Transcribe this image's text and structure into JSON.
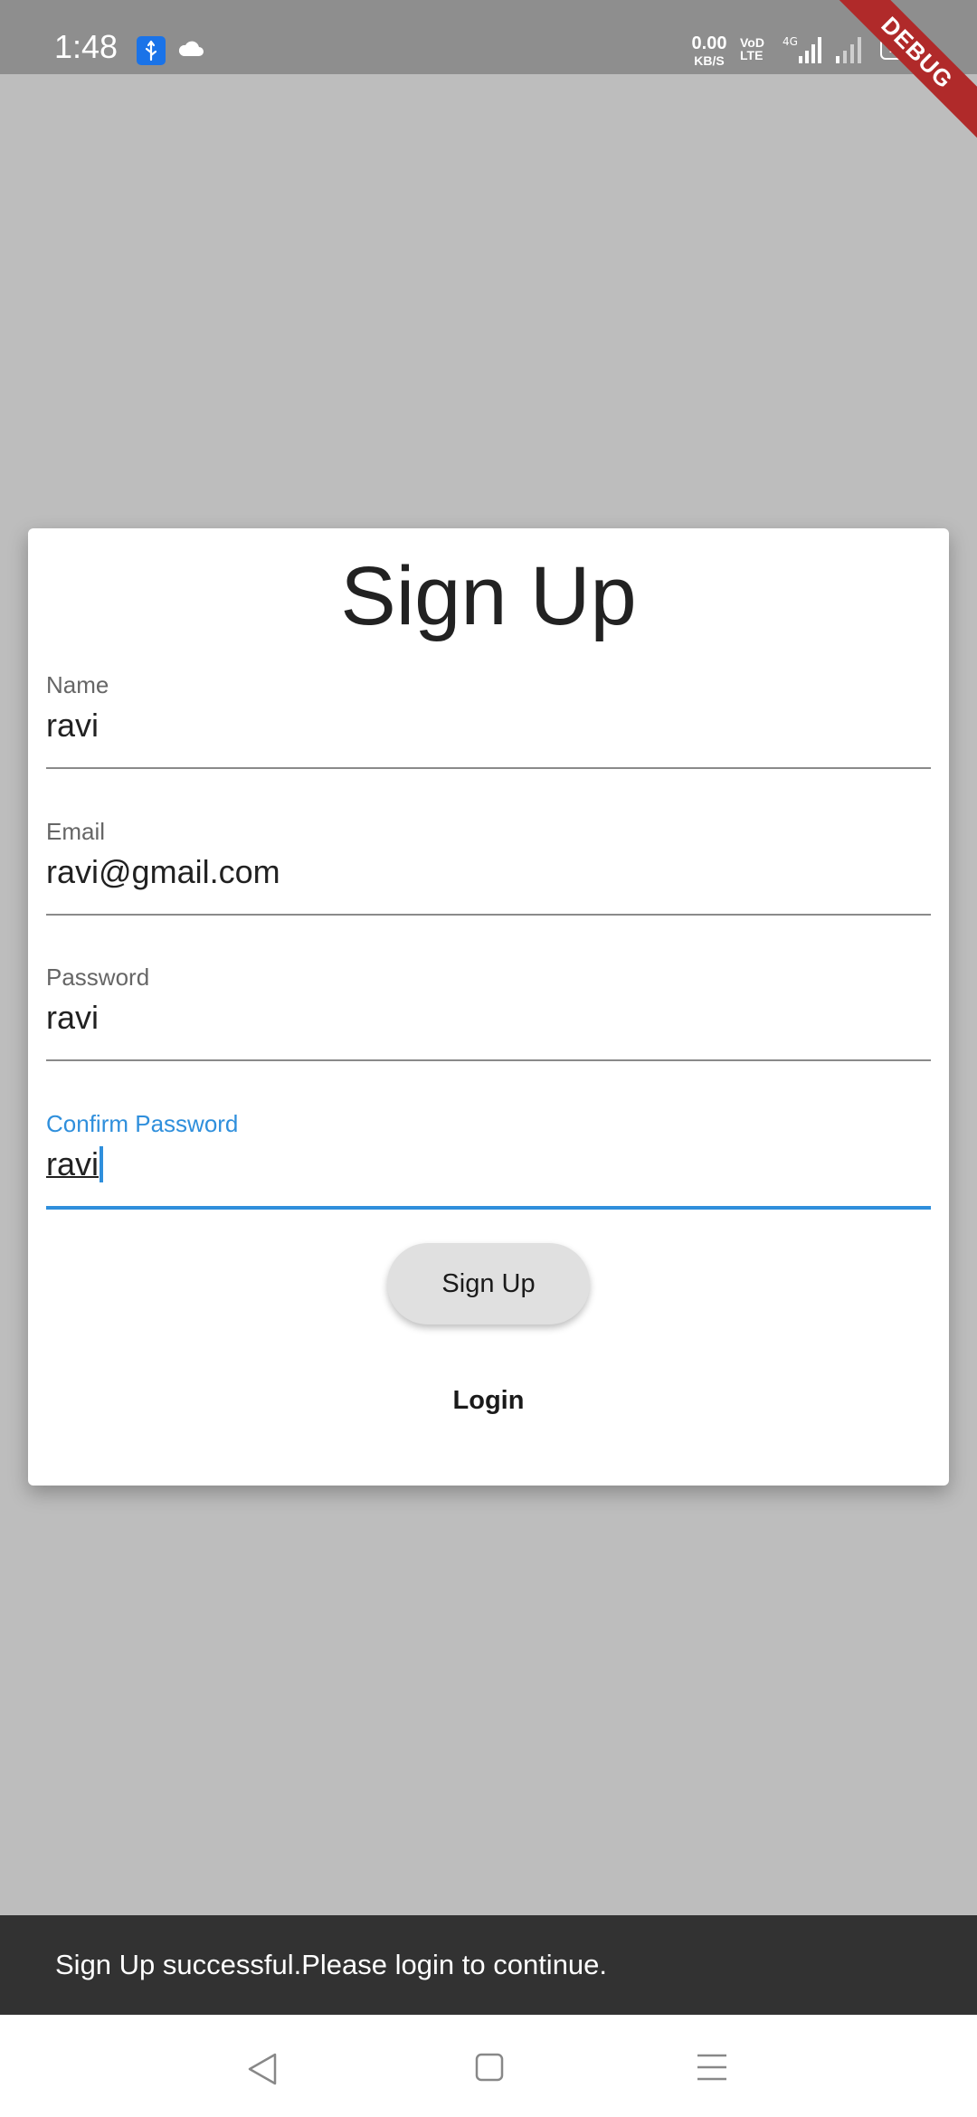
{
  "status_bar": {
    "time": "1:48",
    "net_speed_value": "0.00",
    "net_speed_unit": "KB/S",
    "volte_top": "VoD",
    "volte_bottom": "LTE",
    "network_type": "4G",
    "battery": "100",
    "debug_banner": "DEBUG",
    "icons": [
      "usb-icon",
      "cloud-icon",
      "signal-icon",
      "battery-icon"
    ]
  },
  "form": {
    "title": "Sign Up",
    "fields": [
      {
        "label": "Name",
        "value": "ravi"
      },
      {
        "label": "Email",
        "value": "ravi@gmail.com"
      },
      {
        "label": "Password",
        "value": "ravi"
      },
      {
        "label": "Confirm Password",
        "value": "ravi"
      }
    ],
    "signup_button": "Sign Up",
    "login_link": "Login"
  },
  "snackbar": {
    "message": "Sign Up successful.Please login to continue."
  },
  "nav_bar": {
    "icons": [
      "back-icon",
      "home-icon",
      "menu-icon"
    ]
  },
  "colors": {
    "accent": "#2f8fdc",
    "background": "#bdbdbd",
    "snackbar": "#323232",
    "status_bar": "#8e8e8e"
  }
}
